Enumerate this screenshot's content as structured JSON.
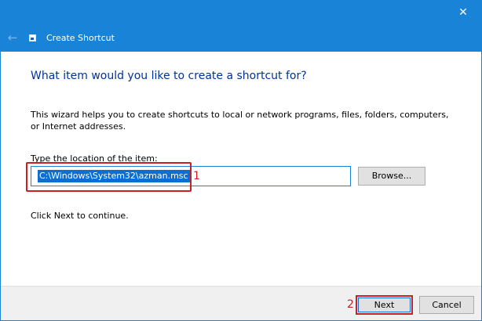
{
  "window": {
    "close_glyph": "✕",
    "back_glyph": "←",
    "title": "Create Shortcut"
  },
  "wizard": {
    "question": "What item would you like to create a shortcut for?",
    "intro": "This wizard helps you to create shortcuts to local or network programs, files, folders, computers, or Internet addresses.",
    "location_label": "Type the location of the item:",
    "location_value": "C:\\Windows\\System32\\azman.msc",
    "browse_label": "Browse...",
    "continue_text": "Click Next to continue."
  },
  "annotations": {
    "step1": "1",
    "step2": "2",
    "color": "#cc1f1f"
  },
  "footer": {
    "next_label": "Next",
    "cancel_label": "Cancel"
  },
  "colors": {
    "accent": "#1883d7",
    "heading": "#003399",
    "selection": "#0a6fd3"
  }
}
